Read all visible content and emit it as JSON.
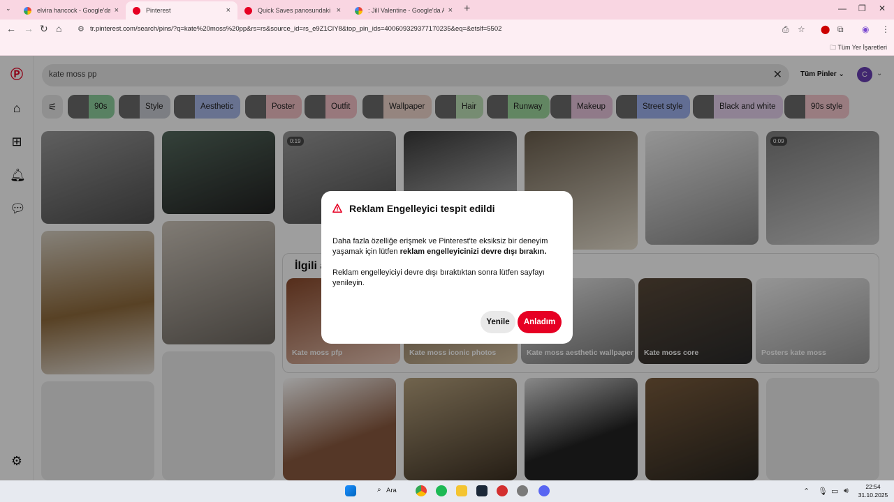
{
  "browser": {
    "tabs": [
      {
        "title": "elvira hancock - Google'da Ara",
        "favicon": "google-icon",
        "active": false
      },
      {
        "title": "Pinterest",
        "favicon": "pinterest-icon",
        "active": true
      },
      {
        "title": "Quick Saves panosundaki Pin",
        "favicon": "pinterest-icon",
        "active": false
      },
      {
        "title": ": Jill Valentine - Google'da Ara",
        "favicon": "google-icon",
        "active": false
      }
    ],
    "url": "tr.pinterest.com/search/pins/?q=kate%20moss%20pp&rs=rs&source_id=rs_e9Z1CIY8&top_pin_ids=400609329377170235&eq=&etslf=5502",
    "bookmarks_label": "Tüm Yer İşaretleri"
  },
  "search": {
    "query": "kate moss pp",
    "filter_label": "Tüm Pinler",
    "avatar_initial": "C"
  },
  "chips": [
    {
      "label": "90s",
      "color": "#8fd19e"
    },
    {
      "label": "Style",
      "color": "#c9ccd3"
    },
    {
      "label": "Aesthetic",
      "color": "#a9b8e8"
    },
    {
      "label": "Poster",
      "color": "#f3c1c6"
    },
    {
      "label": "Outfit",
      "color": "#f6c2c9"
    },
    {
      "label": "Wallpaper",
      "color": "#f0d7cd"
    },
    {
      "label": "Hair",
      "color": "#bfe3b8"
    },
    {
      "label": "Runway",
      "color": "#9fd99e"
    },
    {
      "label": "Makeup",
      "color": "#e9c6dd"
    },
    {
      "label": "Street style",
      "color": "#9fb2ef"
    },
    {
      "label": "Black and white",
      "color": "#e7d2ef"
    },
    {
      "label": "90s style",
      "color": "#f7c8cf"
    }
  ],
  "pins": {
    "durations": [
      "0:19",
      "0:09"
    ]
  },
  "related": {
    "title": "İlgili a",
    "cards": [
      "Kate moss pfp",
      "Kate moss iconic photos",
      "Kate moss aesthetic wallpaper",
      "Kate moss core",
      "Posters kate moss"
    ]
  },
  "modal": {
    "title": "Reklam Engelleyici tespit edildi",
    "p1_text": "Daha fazla özelliğe erişmek ve Pinterest'te eksiksiz bir deneyim yaşamak için lütfen ",
    "p1_bold": "reklam engelleyicinizi devre dışı bırakın.",
    "p2": "Reklam engelleyiciyi devre dışı bıraktıktan sonra lütfen sayfayı yenileyin.",
    "reload_label": "Yenile",
    "ok_label": "Anladım",
    "accent": "#e60023"
  },
  "taskbar": {
    "search_label": "Ara",
    "time": "22:54",
    "date": "31.10.2025"
  }
}
